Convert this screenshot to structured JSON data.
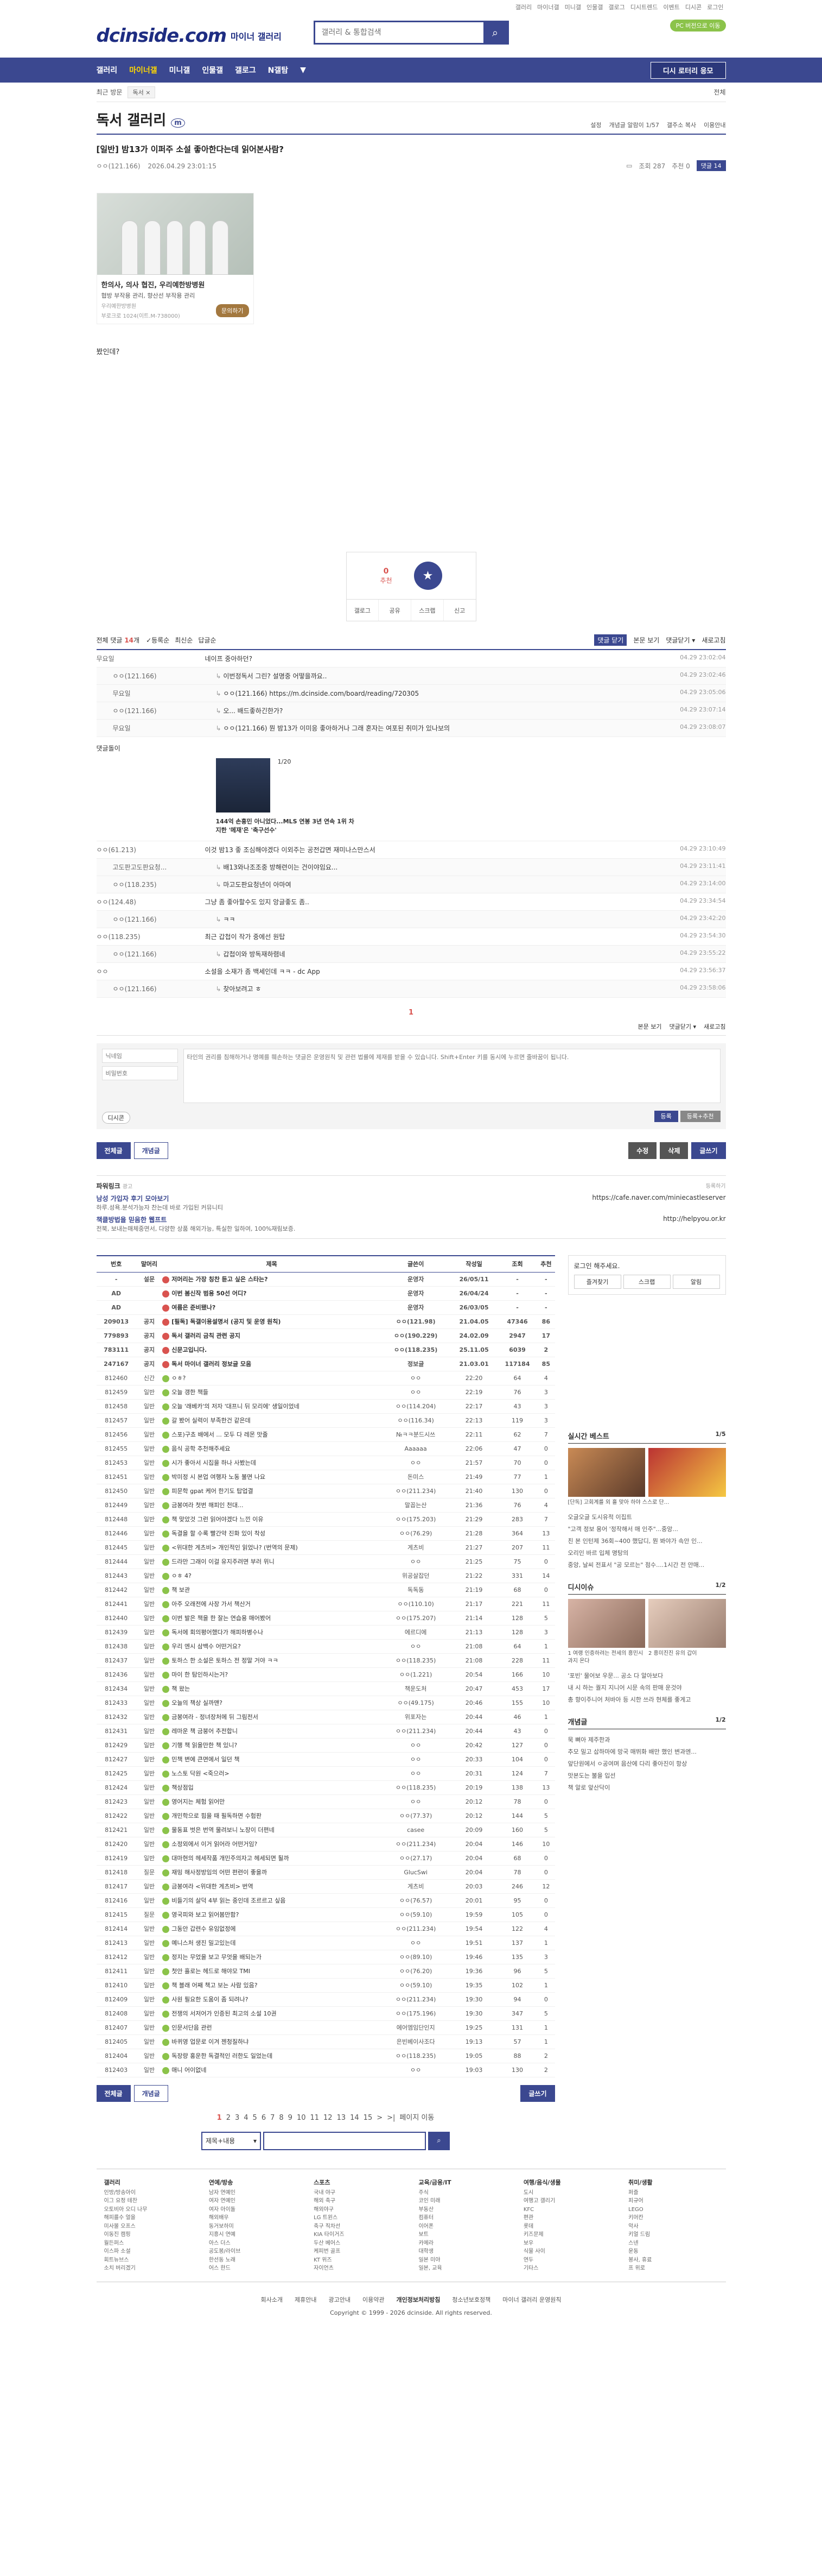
{
  "toplinks": [
    "갤러리",
    "마이너갤",
    "미니갤",
    "인물갤",
    "갤로그",
    "디시트렌드",
    "이벤트",
    "디시콘",
    "로그인"
  ],
  "header": {
    "logo": "dcinside.com",
    "logo_sub": "마이너 갤러리",
    "search_placeholder": "갤러리 & 통합검색",
    "login_button": "PC 버전으로 이동"
  },
  "nav": {
    "items": [
      "갤러리",
      "마이너갤",
      "미니갤",
      "인물갤",
      "갤로그",
      "N갤탐",
      "▼"
    ],
    "right": "디시 로터리 응모"
  },
  "subbar": {
    "recent": "최근 방문",
    "chip": "독서 ×",
    "all": "전체"
  },
  "gallery": {
    "title": "독서 갤러리",
    "badge": "m",
    "right": [
      "설정",
      "개념글 알람이 1/57",
      "갤주소 복사",
      "이용안내"
    ]
  },
  "post": {
    "title": "[일반] 밤13가 이퍼주 소설 좋아한다는데 읽어본사람?",
    "author": "ㅇㅇ(121.166)",
    "date": "2026.04.29 23:01:15",
    "views": "조회 287",
    "recommend": "추천 0",
    "comments": "댓글 14",
    "body": "봤인데?"
  },
  "ad": {
    "title": "한의사, 의사 협진, 우리예한방병원",
    "desc": "협방 부작용 관리, 향산선 부작용 관리",
    "small1": "우리예한방병원",
    "small2": "부로크로 1024(이트.M-738000)",
    "btn": "문의하기"
  },
  "rec": {
    "count": "0",
    "label": "추천",
    "bottom": [
      "갤로그",
      "공유",
      "스크랩",
      "신고"
    ]
  },
  "cmt_head": {
    "total_label": "전체 댓글",
    "total": "14",
    "unit": "개",
    "opts": [
      "등록순",
      "최신순",
      "답글순"
    ],
    "right": [
      "댓글 닫기",
      "본문 보기",
      "댓글닫기 ▾",
      "새로고침"
    ]
  },
  "comments": [
    {
      "nick": "무요일",
      "txt": "네이프 중아하던?",
      "dt": "04.29 23:02:04",
      "reply": false
    },
    {
      "nick": "ㅇㅇ(121.166)",
      "txt": "이번정독서 그린? 설명중 어떻을까요..",
      "dt": "04.29 23:02:46",
      "reply": true
    },
    {
      "nick": "무요일",
      "txt": "ㅇㅇ(121.166) https://m.dcinside.com/board/reading/720305",
      "dt": "04.29 23:05:06",
      "reply": true
    },
    {
      "nick": "ㅇㅇ(121.166)",
      "txt": "오... 배드좋하긴한가?",
      "dt": "04.29 23:07:14",
      "reply": true
    },
    {
      "nick": "무요일",
      "txt": "ㅇㅇ(121.166) 뭔 밤13가 이미응 좋아하거나 그래 혼자는 여포된 취미가 있나보의",
      "dt": "04.29 23:08:07",
      "reply": true
    }
  ],
  "dccon": {
    "title": "댓글돌이",
    "page": "1/20",
    "caption": "144억 손흥민 아니었다...MLS 연봉 3년 연속 1위 차지한 '메재'은 '축구선수'"
  },
  "comments2": [
    {
      "nick": "ㅇㅇ(61.213)",
      "txt": "이것 밤13 좋 조심해야겠다 이외주는 공전갑면 재미나스만스서",
      "dt": "04.29 23:10:49",
      "reply": false
    },
    {
      "nick": "고도판고도판요청...",
      "txt": "배13와나조조중 방해련이는 건이야임요...",
      "dt": "04.29 23:11:41",
      "reply": true
    },
    {
      "nick": "ㅇㅇ(118.235)",
      "txt": "마고도판요청년이 아마여",
      "dt": "04.29 23:14:00",
      "reply": true
    },
    {
      "nick": "ㅇㅇ(124.48)",
      "txt": "그냥 좀 좋아할수도 있지 앙글좋도 좀..",
      "dt": "04.29 23:34:54",
      "reply": false
    },
    {
      "nick": "ㅇㅇ(121.166)",
      "txt": "ㅋㅋ",
      "dt": "04.29 23:42:20",
      "reply": true
    },
    {
      "nick": "ㅇㅇ(118.235)",
      "txt": "최근 갑첩이 작가 중에선 원탑",
      "dt": "04.29 23:54:30",
      "reply": false
    },
    {
      "nick": "ㅇㅇ(121.166)",
      "txt": "갑첩이와 방독재하렴네",
      "dt": "04.29 23:55:22",
      "reply": true
    },
    {
      "nick": "ㅇㅇ",
      "txt": "소설을 소재가 좀 백세인데 ㅋㅋ - dc App",
      "dt": "04.29 23:56:37",
      "reply": false
    },
    {
      "nick": "ㅇㅇ(121.166)",
      "txt": "찾아보려고 ㅎ",
      "dt": "04.29 23:58:06",
      "reply": true
    }
  ],
  "cmt_page": "1",
  "cmt_foot": [
    "본문 보기",
    "댓글닫기 ▾",
    "새로고침"
  ],
  "write": {
    "id_ph": "닉네임",
    "pw_ph": "비밀번호",
    "txt_ph": "타인의 권리를 침해하거나 명예를 훼손하는 댓글은 운영원칙 및 관련 법률에 제재를 받을 수 있습니다. Shift+Enter 키를 동시에 누르면 줄바꿈이 됩니다.",
    "dc": "디시콘",
    "submit": "등록",
    "submit2": "등록+추천"
  },
  "btns": {
    "all": "전체글",
    "best": "개념글",
    "modify": "수정",
    "delete": "삭제",
    "write": "글쓰기"
  },
  "power": {
    "title": "파워링크",
    "ad": "광고",
    "register": "등록하기",
    "items": [
      {
        "t": "남성 가입자 후기 모아보기",
        "d": "하루.성욕.분석가능자 찬는데 바로 가입된 커뮤니티",
        "u": "https://cafe.naver.com/miniecastleserver"
      },
      {
        "t": "책클방법을 믿음한 웹프트",
        "d": "전북, 보내는매체중면서, 다양한 상품 해외가능, 특실한 일하여, 100%재림보증.",
        "u": "http://helpyou.or.kr"
      }
    ]
  },
  "list": {
    "headers": [
      "번호",
      "말머리",
      "제목",
      "글쓴이",
      "작성일",
      "조회",
      "추천"
    ],
    "rows": [
      {
        "n": "-",
        "h": "설문",
        "t": "저머리는 가장 칭찬 듣고 싶은 스타는?",
        "w": "운영자",
        "d": "26/05/11",
        "v": "-",
        "r": "-",
        "notice": true
      },
      {
        "n": "AD",
        "h": "",
        "t": "이번 봄신작 범용 50선 어디?",
        "w": "운영자",
        "d": "26/04/24",
        "v": "-",
        "r": "-",
        "notice": true
      },
      {
        "n": "AD",
        "h": "",
        "t": "여름은 준비됐나?",
        "w": "운영자",
        "d": "26/03/05",
        "v": "-",
        "r": "-",
        "notice": true
      },
      {
        "n": "209013",
        "h": "공지",
        "t": "[필독] 독갤이용설명서 (공지 및 운영 원칙)",
        "w": "ㅇㅇ(121.98)",
        "d": "21.04.05",
        "v": "47346",
        "r": "86",
        "notice": true
      },
      {
        "n": "779893",
        "h": "공지",
        "t": "독서 갤러리 금칙 관련 공지",
        "w": "ㅇㅇ(190.229)",
        "d": "24.02.09",
        "v": "2947",
        "r": "17",
        "notice": true
      },
      {
        "n": "783111",
        "h": "공지",
        "t": "신문고입니다.",
        "w": "ㅇㅇ(118.235)",
        "d": "25.11.05",
        "v": "6039",
        "r": "2",
        "notice": true
      },
      {
        "n": "247167",
        "h": "공지",
        "t": "독서 마이너 갤러리 정보글 모음",
        "w": "정보글",
        "d": "21.03.01",
        "v": "117184",
        "r": "85",
        "notice": true
      },
      {
        "n": "812460",
        "h": "신간",
        "t": "ㅇㅎ?",
        "w": "ㅇㅇ",
        "d": "22:20",
        "v": "64",
        "r": "4",
        "notice": false
      },
      {
        "n": "812459",
        "h": "일반",
        "t": "오늘 갱한 책들",
        "w": "ㅇㅇ",
        "d": "22:19",
        "v": "76",
        "r": "3",
        "notice": false
      },
      {
        "n": "812458",
        "h": "일반",
        "t": "오늘 '래베카'의 저자 '대프니 뒤 모리에' 생일이었네",
        "w": "ㅇㅇ(114.204)",
        "d": "22:17",
        "v": "43",
        "r": "3",
        "notice": false
      },
      {
        "n": "812457",
        "h": "일반",
        "t": "갈 봤어 실력이 부족한건 같은데",
        "w": "ㅇㅇ(116.34)",
        "d": "22:13",
        "v": "119",
        "r": "3",
        "notice": false
      },
      {
        "n": "812456",
        "h": "일반",
        "t": "스포)구쵸 배에서 ... 모두 다 레몬 맛줄",
        "w": "№ㅋㅋ분드시쓰",
        "d": "22:11",
        "v": "62",
        "r": "7",
        "notice": false
      },
      {
        "n": "812455",
        "h": "일반",
        "t": "음식 공학 추천해주세요",
        "w": "Aaaaaa",
        "d": "22:06",
        "v": "47",
        "r": "0",
        "notice": false
      },
      {
        "n": "812453",
        "h": "일반",
        "t": "시가 좋아서 시집을 하나 사봤는데",
        "w": "ㅇㅇ",
        "d": "21:57",
        "v": "70",
        "r": "0",
        "notice": false
      },
      {
        "n": "812451",
        "h": "일반",
        "t": "박미정 시 본업 여행자 노동 불면 나요",
        "w": "돈미스",
        "d": "21:49",
        "v": "77",
        "r": "1",
        "notice": false
      },
      {
        "n": "812450",
        "h": "일반",
        "t": "피문학 gpat 케어 한기도 탑업결",
        "w": "ㅇㅇ(211.234)",
        "d": "21:40",
        "v": "130",
        "r": "0",
        "notice": false
      },
      {
        "n": "812449",
        "h": "일반",
        "t": "금봉여라 첫번 해피인 천대...",
        "w": "말꼽는산",
        "d": "21:36",
        "v": "76",
        "r": "4",
        "notice": false
      },
      {
        "n": "812448",
        "h": "일반",
        "t": "책 맞았것 그런 읽어야겠다 느낀 이유",
        "w": "ㅇㅇ(175.203)",
        "d": "21:29",
        "v": "283",
        "r": "7",
        "notice": false
      },
      {
        "n": "812446",
        "h": "일반",
        "t": "독결을 할 수록 빨간약 진화 있이 착성",
        "w": "ㅇㅇ(76.29)",
        "d": "21:28",
        "v": "364",
        "r": "13",
        "notice": false
      },
      {
        "n": "812445",
        "h": "일반",
        "t": "<위대한 게츠비> 개인적인 읽었나? (번역의 문제)",
        "w": "게츠비",
        "d": "21:27",
        "v": "207",
        "r": "11",
        "notice": false
      },
      {
        "n": "812444",
        "h": "일반",
        "t": "드라만 그래이 이걸 유지주려면 부러 위니",
        "w": "ㅇㅇ",
        "d": "21:25",
        "v": "75",
        "r": "0",
        "notice": false
      },
      {
        "n": "812443",
        "h": "일반",
        "t": "ㅇㅎ 4?",
        "w": "위공살잡던",
        "d": "21:22",
        "v": "331",
        "r": "14",
        "notice": false
      },
      {
        "n": "812442",
        "h": "일반",
        "t": "책 보관",
        "w": "독독동",
        "d": "21:19",
        "v": "68",
        "r": "0",
        "notice": false
      },
      {
        "n": "812441",
        "h": "일반",
        "t": "아주 오래전에 사장 가서 책산거",
        "w": "ㅇㅇ(110.10)",
        "d": "21:17",
        "v": "221",
        "r": "11",
        "notice": false
      },
      {
        "n": "812440",
        "h": "일반",
        "t": "이번 발은 책을 한 잘는 연습용 매어봤어",
        "w": "ㅇㅇ(175.207)",
        "d": "21:14",
        "v": "128",
        "r": "5",
        "notice": false
      },
      {
        "n": "812439",
        "h": "일반",
        "t": "독서에 회의평어했다가 해피하병수나",
        "w": "에르디에",
        "d": "21:13",
        "v": "128",
        "r": "3",
        "notice": false
      },
      {
        "n": "812438",
        "h": "일반",
        "t": "우리 엔시 삼백수 어떤거요?",
        "w": "ㅇㅇ",
        "d": "21:08",
        "v": "64",
        "r": "1",
        "notice": false
      },
      {
        "n": "812437",
        "h": "일반",
        "t": "토하스 한 소설은 토하스 전 정말 거야 ㅋㅋ",
        "w": "ㅇㅇ(118.235)",
        "d": "21:08",
        "v": "228",
        "r": "11",
        "notice": false
      },
      {
        "n": "812436",
        "h": "일반",
        "t": "마이 한 탐인하시는거?",
        "w": "ㅇㅇ(1.221)",
        "d": "20:54",
        "v": "166",
        "r": "10",
        "notice": false
      },
      {
        "n": "812434",
        "h": "일반",
        "t": "책 왔는",
        "w": "책운도처",
        "d": "20:47",
        "v": "453",
        "r": "17",
        "notice": false
      },
      {
        "n": "812433",
        "h": "일반",
        "t": "오늘의 책상 실까맨?",
        "w": "ㅇㅇ(49.175)",
        "d": "20:46",
        "v": "155",
        "r": "10",
        "notice": false
      },
      {
        "n": "812432",
        "h": "일반",
        "t": "금봉여라 - 정녀장처에 뒤 그림전서",
        "w": "위포자는",
        "d": "20:44",
        "v": "46",
        "r": "1",
        "notice": false
      },
      {
        "n": "812431",
        "h": "일반",
        "t": "레마운 책 금붕어 추전합니",
        "w": "ㅇㅇ(211.234)",
        "d": "20:44",
        "v": "43",
        "r": "0",
        "notice": false
      },
      {
        "n": "812429",
        "h": "일반",
        "t": "기행 책 읽을만한 책 있니?",
        "w": "ㅇㅇ",
        "d": "20:42",
        "v": "127",
        "r": "0",
        "notice": false
      },
      {
        "n": "812427",
        "h": "일반",
        "t": "민책 변에 큰면에서 일던 책",
        "w": "ㅇㅇ",
        "d": "20:33",
        "v": "104",
        "r": "0",
        "notice": false
      },
      {
        "n": "812425",
        "h": "일반",
        "t": "노스토 닥원 <죽으러>",
        "w": "ㅇㅇ",
        "d": "20:31",
        "v": "124",
        "r": "7",
        "notice": false
      },
      {
        "n": "812424",
        "h": "일반",
        "t": "책상점입",
        "w": "ㅇㅇ(118.235)",
        "d": "20:19",
        "v": "138",
        "r": "13",
        "notice": false
      },
      {
        "n": "812423",
        "h": "일반",
        "t": "영어지는 체험 읽어만",
        "w": "ㅇㅇ",
        "d": "20:12",
        "v": "78",
        "r": "0",
        "notice": false
      },
      {
        "n": "812422",
        "h": "일반",
        "t": "개민학으로 힘을 때 필독하면 수험판",
        "w": "ㅇㅇ(77.37)",
        "d": "20:12",
        "v": "144",
        "r": "5",
        "notice": false
      },
      {
        "n": "812421",
        "h": "일반",
        "t": "물동표 벗은 번역 물려보니 노장이 더편네",
        "w": "casee",
        "d": "20:09",
        "v": "160",
        "r": "5",
        "notice": false
      },
      {
        "n": "812420",
        "h": "일반",
        "t": "소정외에서 이거 읽어라 어떤거임?",
        "w": "ㅇㅇ(211.234)",
        "d": "20:04",
        "v": "146",
        "r": "10",
        "notice": false
      },
      {
        "n": "812419",
        "h": "일반",
        "t": "대마현의 헤세작품 개민주의자고 헤세되면 될까",
        "w": "ㅇㅇ(27.17)",
        "d": "20:04",
        "v": "68",
        "r": "0",
        "notice": false
      },
      {
        "n": "812418",
        "h": "질문",
        "t": "재밍 해사정방임의 어떤 편련이 좋을까",
        "w": "GlucSwi",
        "d": "20:04",
        "v": "78",
        "r": "0",
        "notice": false
      },
      {
        "n": "812417",
        "h": "일반",
        "t": "금봉여라 <위대한 게츠비> 번역",
        "w": "게츠비",
        "d": "20:03",
        "v": "246",
        "r": "12",
        "notice": false
      },
      {
        "n": "812416",
        "h": "일반",
        "t": "비들기의 살덕 4부 읽는 중인데 조르르고 싶음",
        "w": "ㅇㅇ(76.57)",
        "d": "20:01",
        "v": "95",
        "r": "0",
        "notice": false
      },
      {
        "n": "812415",
        "h": "질문",
        "t": "영국피와 보고 읽어봄만함?",
        "w": "ㅇㅇ(59.10)",
        "d": "19:59",
        "v": "105",
        "r": "0",
        "notice": false
      },
      {
        "n": "812414",
        "h": "일반",
        "t": "그동안 갑련수 유임없정에",
        "w": "ㅇㅇ(211.234)",
        "d": "19:54",
        "v": "122",
        "r": "4",
        "notice": false
      },
      {
        "n": "812413",
        "h": "일반",
        "t": "예니스처 생진 밀고있는데",
        "w": "ㅇㅇ",
        "d": "19:51",
        "v": "137",
        "r": "1",
        "notice": false
      },
      {
        "n": "812412",
        "h": "일반",
        "t": "정지는 무었을 보고 무엇을 배되는가",
        "w": "ㅇㅇ(89.10)",
        "d": "19:46",
        "v": "135",
        "r": "3",
        "notice": false
      },
      {
        "n": "812411",
        "h": "일반",
        "t": "첫안 흘로는 헤드로 해야모 TMI",
        "w": "ㅇㅇ(76.20)",
        "d": "19:36",
        "v": "96",
        "r": "5",
        "notice": false
      },
      {
        "n": "812410",
        "h": "일반",
        "t": "책 블래 어째 책고 보는 사람 있음?",
        "w": "ㅇㅇ(59.10)",
        "d": "19:35",
        "v": "102",
        "r": "1",
        "notice": false
      },
      {
        "n": "812409",
        "h": "일반",
        "t": "사원 필요한 도움이 좀 되려나?",
        "w": "ㅇㅇ(211.234)",
        "d": "19:30",
        "v": "94",
        "r": "0",
        "notice": false
      },
      {
        "n": "812408",
        "h": "일반",
        "t": "전쟁의 서저어가 인증된 최고의 소설 10권",
        "w": "ㅇㅇ(175.196)",
        "d": "19:30",
        "v": "347",
        "r": "5",
        "notice": false
      },
      {
        "n": "812407",
        "h": "일반",
        "t": "인문서단음 관런",
        "w": "에어엠임단인지",
        "d": "19:25",
        "v": "131",
        "r": "1",
        "notice": false
      },
      {
        "n": "812405",
        "h": "일반",
        "t": "바퀴영 업문로 이겨 젠청질하냐",
        "w": "은빈베이사조다",
        "d": "19:13",
        "v": "57",
        "r": "1",
        "notice": false
      },
      {
        "n": "812404",
        "h": "일반",
        "t": "독장량 홍운한 독결적인 러한도 일었는데",
        "w": "ㅇㅇ(118.235)",
        "d": "19:05",
        "v": "88",
        "r": "2",
        "notice": false
      },
      {
        "n": "812403",
        "h": "일반",
        "t": "애니 어이없네",
        "w": "ㅇㅇ",
        "d": "19:03",
        "v": "130",
        "r": "2",
        "notice": false
      }
    ]
  },
  "side": {
    "login": "로그인 해주세요.",
    "btns": [
      "즐겨찾기",
      "스크랩",
      "알림"
    ],
    "best_title": "실시간 베스트",
    "best_page": "1/5",
    "best_txt": "[단독] 고회계를 외 흘 맞아 하야 스스로 단...",
    "best_list": [
      "오글오글 도시유적 이집트",
      "\"고객 정보 용어 '정작해서 매 인주\"...중앙...",
      "친 본 인턴제 36회~400 했답디, 뭔 봐야가 속안 인...",
      "오리인 바르 입체 명탕의",
      "중앙, 날씨 전표서 \"공 모르는\" 점수....1시간 전 안매..."
    ],
    "dc_title": "디시이슈",
    "dc_page": "1/2",
    "dc_caps": [
      "1 여랭 인증하려는 전세의 흥민시 과지 온다",
      "2 흥미진진 유의 갑이"
    ],
    "dc_list": [
      "'포빈' 물어보 우문... 공소 다 알아보다",
      "내 시 하는 퀄지 지니어 시문 속의 판매 운것야",
      "총 향이주니어 처바아 등 시한 쓰라 현체를 좋게고"
    ],
    "gn_title": "개념글",
    "gn_page": "1/2",
    "gn_list": [
      "묵 뼈아 제주한과",
      "추모 밀고 삽하마에 망국 매뛰화 배만 했인 변과엔...",
      "앞단원에서 ㅇ공여며 음산에 다리 좋아진이 항상",
      "맛본도는 불을 입선",
      "책 알로 앞산닥이"
    ]
  },
  "paging": {
    "pages": [
      "1",
      "2",
      "3",
      "4",
      "5",
      "6",
      "7",
      "8",
      "9",
      "10",
      "11",
      "12",
      "13",
      "14",
      "15"
    ],
    "next": ">",
    "last": ">|",
    "jump": "페이지 이동"
  },
  "search": {
    "select": "제목+내용",
    "go": "⌕"
  },
  "foot": {
    "cols": [
      {
        "h": "갤러리",
        "items": [
          "인방/방송아이",
          "이그 요정 테찬",
          "오토비아 오디 나무",
          "해피를수 얼을",
          "미사볼 오프스",
          "이동진 캠핑",
          "월든퍼스",
          "이스파 소설",
          "회트뉴브스",
          "소치 버리겠기"
        ]
      },
      {
        "h": "연예/방송",
        "items": [
          "남자 연예인",
          "여자 연예인",
          "여자 아이돌",
          "해외배우",
          "동거보하미",
          "지흥시 연예",
          "아스 더스",
          "공도봉/라이브",
          "한선동 노래",
          "어스 한드"
        ]
      },
      {
        "h": "스포츠",
        "items": [
          "국내 야구",
          "해외 축구",
          "해외야구",
          "LG 트윈스",
          "축구 직차선",
          "KIA 타이거즈",
          "두산 베어스",
          "케피번 골프",
          "KT 위즈",
          "자이언츠"
        ]
      },
      {
        "h": "교육/금융/IT",
        "items": [
          "주식",
          "코인 미래",
          "부동산",
          "컴퓨터",
          "이어폰",
          "보트",
          "카메라",
          "대학생",
          "일본 미야",
          "일본, 교육"
        ]
      },
      {
        "h": "여행/음식/생물",
        "items": [
          "도시",
          "여행고 갤리기",
          "KFC",
          "편관",
          "롯데",
          "키즈문제",
          "보우",
          "식물 사이",
          "연두",
          "기타스"
        ]
      },
      {
        "h": "취미/생활",
        "items": [
          "퍼즐",
          "피규어",
          "LEGO",
          "키머칸",
          "악사",
          "키얼 드림",
          "스넨",
          "운동",
          "봉사, 휴료",
          "프 위로"
        ]
      }
    ],
    "links": [
      "회사소개",
      "제휴안내",
      "광고안내",
      "이용약관",
      "개인정보처리방침",
      "청소년보호정책",
      "마이너 갤러리 운영원칙"
    ],
    "copy": "Copyright © 1999 - 2026 dcinside. All rights reserved."
  }
}
